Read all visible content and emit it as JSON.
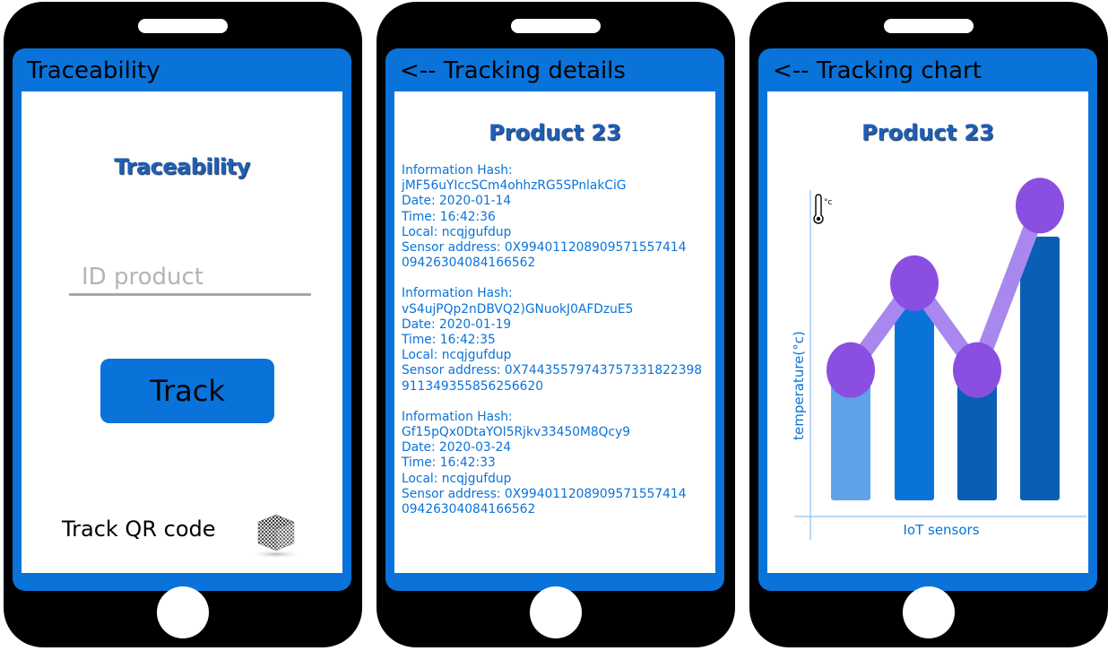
{
  "phone1": {
    "title": "Traceability",
    "heading": "Traceability",
    "input_placeholder": "ID product",
    "track_button": "Track",
    "qr_label": "Track QR code",
    "qr_icon": "qr-cube-icon"
  },
  "phone2": {
    "title": "<-- Tracking details",
    "heading": "Product 23",
    "records": [
      {
        "hash_label": "Information Hash:",
        "hash": "jMF56uYIccSCm4ohhzRG5SPnlakCiG",
        "date": "Date: 2020-01-14",
        "time": "Time: 16:42:36",
        "local": "Local: ncqjgufdup",
        "sensor": "Sensor address: 0X994011208909571557414",
        "sensor_cont": "09426304084166562"
      },
      {
        "hash_label": "Information Hash:",
        "hash": "vS4ujPQp2nDBVQ2)GNuokJ0AFDzuE5",
        "date": "Date: 2020-01-19",
        "time": "Time: 16:42:35",
        "local": "Local: ncqjgufdup",
        "sensor": "Sensor address: 0X7443557974375733182239​8",
        "sensor_cont": "911349355856256620"
      },
      {
        "hash_label": "Information Hash:",
        "hash": "Gf15pQx0DtaYOI5Rjkv33450M8Qcy9",
        "date": "Date: 2020-03-24",
        "time": "Time: 16:42:33",
        "local": "Local: ncqjgufdup",
        "sensor": "Sensor address: 0X994011208909571557414",
        "sensor_cont": "09426304084166562"
      }
    ]
  },
  "phone3": {
    "title": "<-- Tracking chart",
    "heading": "Product 23",
    "chart_data": {
      "type": "bar",
      "xlabel": "IoT sensors",
      "ylabel": "temperature(°c)",
      "unit_badge": "°c",
      "thermometer_icon": "thermometer-icon",
      "bars": [
        {
          "value": 0.42,
          "color": "#5ea3ea"
        },
        {
          "value": 0.64,
          "color": "#0a73d9"
        },
        {
          "value": 0.42,
          "color": "#0a5fb5"
        },
        {
          "value": 0.85,
          "color": "#0a5fb5"
        }
      ],
      "line": [
        0.42,
        0.7,
        0.42,
        0.95
      ],
      "line_color": "#a888ee",
      "marker_color": "#8a4fe0"
    }
  }
}
